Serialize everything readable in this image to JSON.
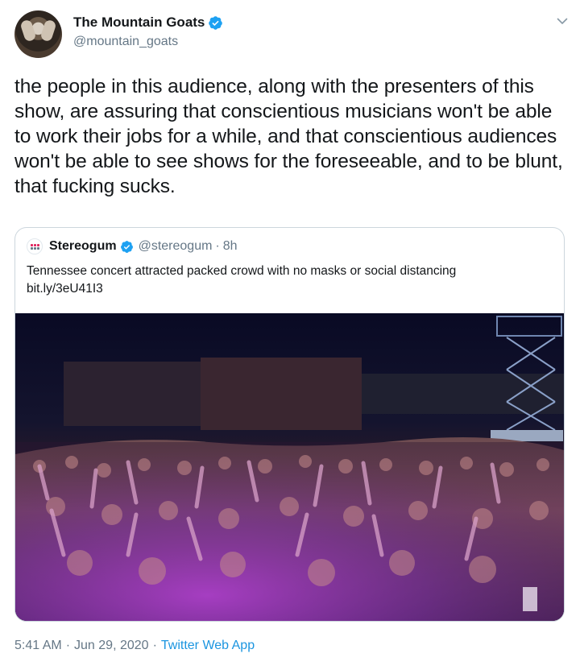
{
  "author": {
    "display_name": "The Mountain Goats",
    "handle": "@mountain_goats",
    "verified": true
  },
  "tweet": {
    "text": "the people in this audience, along with the presenters of this show, are assuring that conscientious musicians won't be able to work their jobs for a while, and that conscientious audiences won't be able to see shows for the foreseeable, and to be blunt, that fucking sucks."
  },
  "quoted_tweet": {
    "display_name": "Stereogum",
    "handle": "@stereogum",
    "dot": "·",
    "time": "8h",
    "text_line1": "Tennessee concert attracted packed crowd with no masks or social distancing",
    "text_line2": "bit.ly/3eU41I3"
  },
  "meta": {
    "time": "5:41 AM",
    "sep1": "·",
    "date": "Jun 29, 2020",
    "sep2": "·",
    "app": "Twitter Web App"
  },
  "colors": {
    "verified_blue": "#1da1f2",
    "link_blue": "#1b95e0",
    "secondary_text": "#657786",
    "border": "#ccd6dd",
    "stereogum_red": "#e0245e"
  },
  "icons": {
    "verified": "verified-badge-icon",
    "more": "chevron-down-icon",
    "stereogum_logo": "stereogum-logo"
  }
}
